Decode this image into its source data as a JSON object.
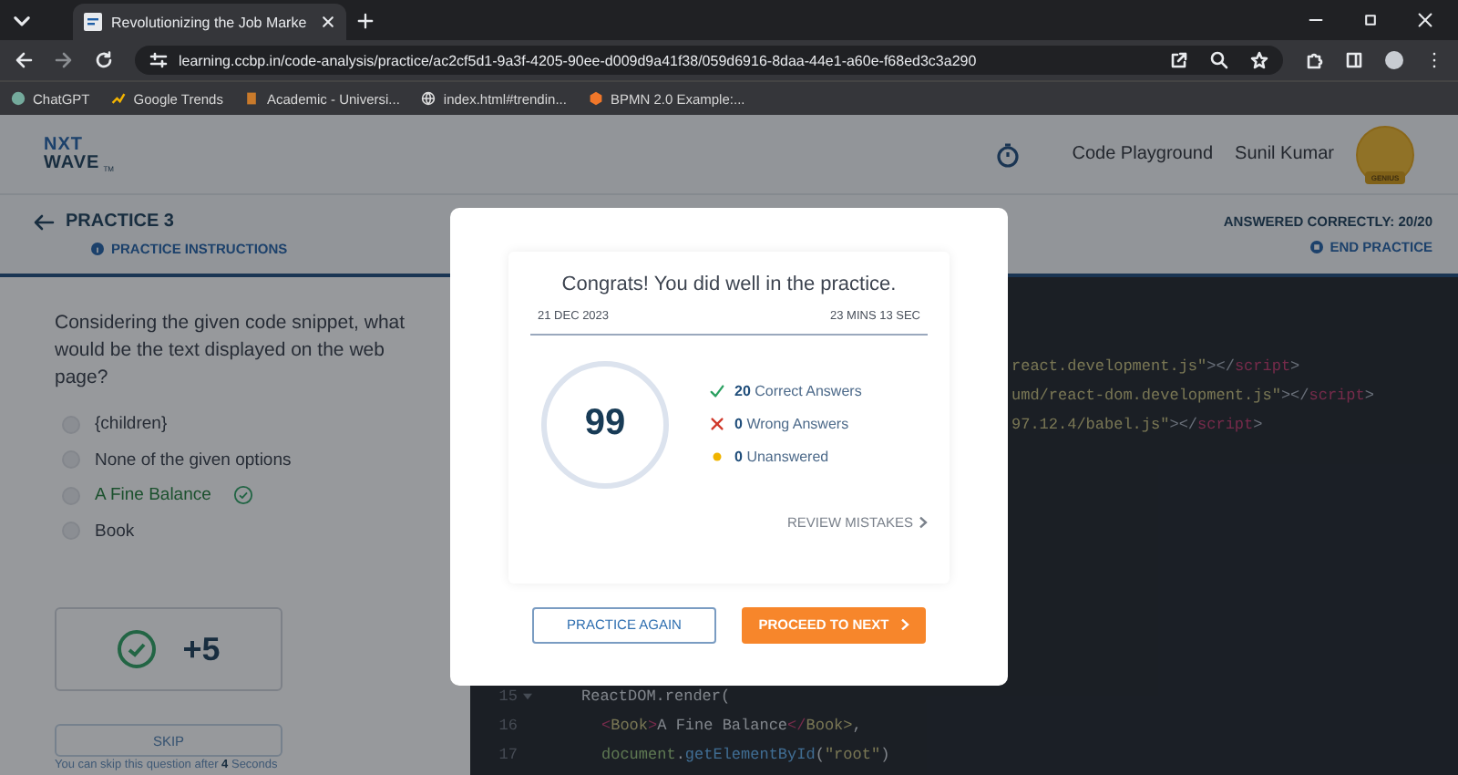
{
  "browser": {
    "tab_title": "Revolutionizing the Job Marke",
    "url": "learning.ccbp.in/code-analysis/practice/ac2cf5d1-9a3f-4205-90ee-d009d9a41f38/059d6916-8daa-44e1-a60e-f68ed3c3a290",
    "bookmarks": [
      {
        "label": "ChatGPT",
        "kind": "chat"
      },
      {
        "label": "Google Trends",
        "kind": "trend"
      },
      {
        "label": "Academic - Universi...",
        "kind": "book"
      },
      {
        "label": "index.html#trendin...",
        "kind": "globe"
      },
      {
        "label": "BPMN 2.0 Example:...",
        "kind": "bpmn"
      }
    ]
  },
  "header": {
    "logo_lines": [
      "NXT",
      "WAVE"
    ],
    "logo_mark": "TM",
    "link": "Code Playground",
    "user_name": "Sunil Kumar",
    "avatar_badge": "GENIUS"
  },
  "practice_bar": {
    "title": "PRACTICE 3",
    "instructions": "PRACTICE INSTRUCTIONS",
    "score": "ANSWERED CORRECTLY: 20/20",
    "end": "END PRACTICE"
  },
  "question": {
    "text": "Considering the given code snippet, what would be the text displayed on the web page?",
    "options": [
      {
        "label": "{children}",
        "selected": false,
        "correct": false
      },
      {
        "label": "None of the given options",
        "selected": false,
        "correct": false
      },
      {
        "label": "A Fine Balance",
        "selected": false,
        "correct": true
      },
      {
        "label": "Book",
        "selected": false,
        "correct": false
      }
    ],
    "points": "+5",
    "skip_button": {
      "label": "SKIP",
      "disabled": true
    },
    "skip_hint": "You can skip this question after **4** Seconds"
  },
  "editor": {
    "fragments": [
      {
        "segments": [
          {
            "kind": "string",
            "text": "react.development.js\""
          },
          {
            "kind": "punct",
            "text": "></"
          },
          {
            "kind": "tag",
            "text": "script"
          },
          {
            "kind": "punct",
            "text": ">"
          }
        ]
      },
      {
        "segments": [
          {
            "kind": "string",
            "text": "umd/react-dom.development.js\""
          },
          {
            "kind": "punct",
            "text": "></"
          },
          {
            "kind": "tag",
            "text": "script"
          },
          {
            "kind": "punct",
            "text": ">"
          }
        ]
      },
      {
        "segments": [
          {
            "kind": "string",
            "text": "97.12.4/babel.js\""
          },
          {
            "kind": "punct",
            "text": "></"
          },
          {
            "kind": "tag",
            "text": "script"
          },
          {
            "kind": "punct",
            "text": ">"
          }
        ]
      }
    ],
    "lines": [
      {
        "number": "15",
        "fold": true,
        "segments": [
          {
            "kind": "plain",
            "text": "ReactDOM.render("
          }
        ]
      },
      {
        "number": "16",
        "fold": false,
        "segments": [
          {
            "kind": "tag",
            "text": "<"
          },
          {
            "kind": "string",
            "text": "Book"
          },
          {
            "kind": "tag",
            "text": ">"
          },
          {
            "kind": "plain",
            "text": "A Fine Balance"
          },
          {
            "kind": "tag",
            "text": "</"
          },
          {
            "kind": "string",
            "text": "Book>"
          },
          {
            "kind": "plain",
            "text": ","
          }
        ]
      },
      {
        "number": "17",
        "fold": false,
        "segments": [
          {
            "kind": "var",
            "text": "document"
          },
          {
            "kind": "plain",
            "text": "."
          },
          {
            "kind": "fn",
            "text": "getElementById"
          },
          {
            "kind": "plain",
            "text": "("
          },
          {
            "kind": "string",
            "text": "\"root\""
          },
          {
            "kind": "plain",
            "text": ")"
          }
        ]
      }
    ]
  },
  "modal": {
    "title": "Congrats! You did well in the practice.",
    "date": "21 DEC 2023",
    "duration": "23 MINS 13 SEC",
    "score": "99",
    "stats": [
      {
        "kind": "correct",
        "count": "20",
        "label": "Correct Answers"
      },
      {
        "kind": "wrong",
        "count": "0",
        "label": "Wrong Answers"
      },
      {
        "kind": "unanswered",
        "count": "0",
        "label": "Unanswered"
      }
    ],
    "review_link": "REVIEW MISTAKES",
    "buttons": [
      {
        "kind": "outline",
        "label": "PRACTICE AGAIN"
      },
      {
        "kind": "primary",
        "label": "PROCEED TO NEXT"
      }
    ]
  }
}
